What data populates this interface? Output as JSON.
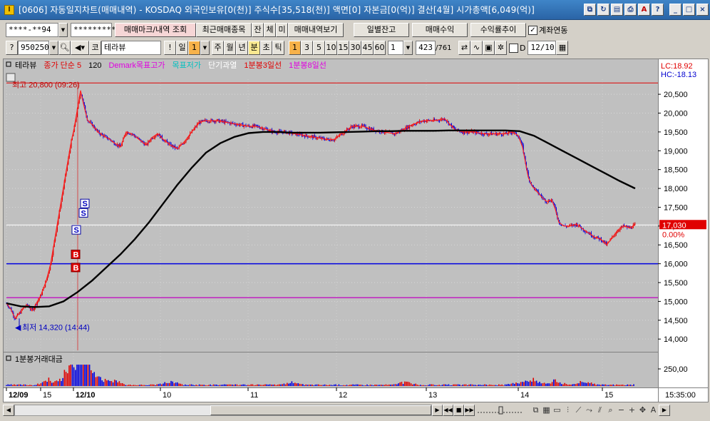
{
  "window": {
    "app_icon": "I",
    "title": "[0606] 자동일지차트(매매내역) - KOSDAQ 외국인보유[0(천)] 주식수[35,518(천)] 액면[0] 자본금[0(억)] 결산[4월] 시가총액[6,049(억)]",
    "title_icons": [
      "link-icon",
      "refresh-icon",
      "window-list-icon",
      "print-icon",
      "font-icon",
      "help-icon"
    ],
    "title_icon_glyphs": [
      "⧉",
      "↻",
      "▤",
      "⎙",
      "A",
      "?"
    ],
    "controls": [
      "_",
      "□",
      "×"
    ]
  },
  "toolbar1": {
    "account": "****-**94",
    "password": "*********",
    "btn_trade_mark": "매매마크/내역 조회",
    "btn_recent": "최근매매종목",
    "btn_jan": "잔",
    "btn_che": "체",
    "btn_mi": "미",
    "btn_history": "매매내역보기",
    "btn_daily_balance": "일별잔고",
    "btn_trade_profit": "매매수익",
    "btn_return_trend": "수익률추이",
    "account_link_checked": true,
    "account_link_label": "계좌연동"
  },
  "toolbar2": {
    "code": "950250",
    "market": "코",
    "stock_name": "테라뷰",
    "excl": "!",
    "period_day": "일",
    "period_num": "1",
    "periods": [
      "주",
      "월",
      "년",
      "분",
      "초",
      "틱"
    ],
    "selected_period": "분",
    "intervals": [
      "1",
      "3",
      "5",
      "10",
      "15",
      "30",
      "45",
      "60"
    ],
    "selected_interval": "1",
    "custom_interval": "1",
    "count": "423",
    "count_total": "/761",
    "d_label": "D",
    "date": "12/10"
  },
  "chart_data": [
    {
      "type": "candlestick",
      "legend": [
        {
          "text": "테라뷰",
          "color": "#000000"
        },
        {
          "text": "종가 단순 5",
          "color": "#e00000"
        },
        {
          "text": "120",
          "color": "#000000"
        },
        {
          "text": "Demark목표고가",
          "color": "#e000e0"
        },
        {
          "text": "목표저가",
          "color": "#00c0c0"
        },
        {
          "text": "단기과열",
          "color": "#ffffff"
        },
        {
          "text": "1분봉3일선",
          "color": "#e00000"
        },
        {
          "text": "1분봉8일선",
          "color": "#e000e0"
        }
      ],
      "ylim": [
        13700,
        20900
      ],
      "y_ticks": [
        14000,
        14500,
        15000,
        15500,
        16000,
        16500,
        17000,
        17500,
        18000,
        18500,
        19000,
        19500,
        20000,
        20500
      ],
      "y_tick_labels": [
        "14,000",
        "14,500",
        "15,000",
        "15,500",
        "16,000",
        "16,500",
        "17,000",
        "17,500",
        "18,000",
        "18,500",
        "19,000",
        "19,500",
        "20,000",
        "20,500"
      ],
      "lc_label": "LC:18.92",
      "hc_label": "HC:-18.13",
      "high": {
        "value": 20800,
        "label": "최고 20,800 (09:26)"
      },
      "low": {
        "value": 14320,
        "label": "최저 14,320 (14:44)"
      },
      "current": {
        "value": 17030,
        "label": "17,030",
        "pct": "0.00%"
      },
      "hline_blue": 16000,
      "hline_purple": 15100,
      "close_path": [
        [
          0,
          14950
        ],
        [
          6,
          14800
        ],
        [
          12,
          14550
        ],
        [
          18,
          14680
        ],
        [
          25,
          14850
        ],
        [
          30,
          14900
        ],
        [
          36,
          14750
        ],
        [
          42,
          14950
        ],
        [
          48,
          15150
        ],
        [
          55,
          15500
        ],
        [
          58,
          15700
        ],
        [
          62,
          16000
        ],
        [
          66,
          16450
        ],
        [
          70,
          16900
        ],
        [
          74,
          17350
        ],
        [
          78,
          17800
        ],
        [
          82,
          18250
        ],
        [
          86,
          18700
        ],
        [
          90,
          19150
        ],
        [
          95,
          19600
        ],
        [
          100,
          20150
        ],
        [
          104,
          20600
        ],
        [
          108,
          20250
        ],
        [
          114,
          19800
        ],
        [
          120,
          19700
        ],
        [
          128,
          19500
        ],
        [
          136,
          19400
        ],
        [
          145,
          19300
        ],
        [
          152,
          19200
        ],
        [
          160,
          19100
        ],
        [
          168,
          19500
        ],
        [
          176,
          19450
        ],
        [
          186,
          19300
        ],
        [
          196,
          19150
        ],
        [
          204,
          19350
        ],
        [
          212,
          19450
        ],
        [
          220,
          19300
        ],
        [
          230,
          19150
        ],
        [
          240,
          19050
        ],
        [
          250,
          19250
        ],
        [
          260,
          19500
        ],
        [
          270,
          19750
        ],
        [
          280,
          19800
        ],
        [
          295,
          19800
        ],
        [
          310,
          19750
        ],
        [
          325,
          19700
        ],
        [
          340,
          19650
        ],
        [
          350,
          19650
        ],
        [
          360,
          19600
        ],
        [
          375,
          19500
        ],
        [
          390,
          19500
        ],
        [
          405,
          19450
        ],
        [
          420,
          19400
        ],
        [
          435,
          19350
        ],
        [
          450,
          19300
        ],
        [
          460,
          19300
        ],
        [
          470,
          19450
        ],
        [
          485,
          19650
        ],
        [
          500,
          19650
        ],
        [
          515,
          19550
        ],
        [
          530,
          19500
        ],
        [
          545,
          19450
        ],
        [
          555,
          19550
        ],
        [
          570,
          19700
        ],
        [
          585,
          19800
        ],
        [
          600,
          19800
        ],
        [
          615,
          19850
        ],
        [
          622,
          19700
        ],
        [
          630,
          19550
        ],
        [
          640,
          19500
        ],
        [
          655,
          19500
        ],
        [
          670,
          19450
        ],
        [
          685,
          19450
        ],
        [
          700,
          19450
        ],
        [
          710,
          19500
        ],
        [
          718,
          19400
        ],
        [
          724,
          19100
        ],
        [
          728,
          18700
        ],
        [
          732,
          18300
        ],
        [
          738,
          18050
        ],
        [
          745,
          17900
        ],
        [
          752,
          17750
        ],
        [
          758,
          17650
        ],
        [
          765,
          17700
        ],
        [
          770,
          17450
        ],
        [
          775,
          17100
        ],
        [
          782,
          17000
        ],
        [
          790,
          17000
        ],
        [
          800,
          17050
        ],
        [
          810,
          16900
        ],
        [
          818,
          16800
        ],
        [
          826,
          16700
        ],
        [
          834,
          16650
        ],
        [
          842,
          16500
        ],
        [
          850,
          16700
        ],
        [
          858,
          16900
        ],
        [
          866,
          17000
        ],
        [
          874,
          16950
        ],
        [
          882,
          17030
        ]
      ],
      "ma120_path": [
        [
          0,
          14950
        ],
        [
          20,
          14870
        ],
        [
          40,
          14850
        ],
        [
          60,
          14870
        ],
        [
          80,
          15000
        ],
        [
          100,
          15250
        ],
        [
          120,
          15550
        ],
        [
          140,
          15900
        ],
        [
          160,
          16250
        ],
        [
          180,
          16650
        ],
        [
          200,
          17100
        ],
        [
          220,
          17600
        ],
        [
          240,
          18100
        ],
        [
          260,
          18550
        ],
        [
          280,
          18950
        ],
        [
          300,
          19200
        ],
        [
          320,
          19370
        ],
        [
          340,
          19470
        ],
        [
          360,
          19500
        ],
        [
          380,
          19500
        ],
        [
          400,
          19480
        ],
        [
          420,
          19480
        ],
        [
          440,
          19480
        ],
        [
          460,
          19490
        ],
        [
          480,
          19500
        ],
        [
          500,
          19510
        ],
        [
          520,
          19520
        ],
        [
          540,
          19520
        ],
        [
          560,
          19530
        ],
        [
          580,
          19530
        ],
        [
          600,
          19530
        ],
        [
          620,
          19540
        ],
        [
          640,
          19540
        ],
        [
          660,
          19540
        ],
        [
          680,
          19540
        ],
        [
          700,
          19540
        ],
        [
          720,
          19520
        ],
        [
          740,
          19400
        ],
        [
          760,
          19200
        ],
        [
          780,
          19000
        ],
        [
          800,
          18800
        ],
        [
          820,
          18600
        ],
        [
          840,
          18400
        ],
        [
          860,
          18200
        ],
        [
          882,
          18000
        ]
      ],
      "markers": [
        {
          "label": "S",
          "x": 110,
          "value": 17600
        },
        {
          "label": "S",
          "x": 108,
          "value": 17350
        },
        {
          "label": "S",
          "x": 98,
          "value": 16900
        },
        {
          "label": "B",
          "x": 97,
          "value": 16250
        },
        {
          "label": "B",
          "x": 97,
          "value": 15900
        }
      ]
    },
    {
      "type": "bar",
      "legend": [
        {
          "text": "1분봉거래대금",
          "color": "#000000"
        }
      ],
      "y_tick_labels": [
        "250,00"
      ],
      "ylim": [
        0,
        300
      ],
      "volume_bursts": [
        {
          "x": 60,
          "value": 60
        },
        {
          "x": 85,
          "value": 120
        },
        {
          "x": 95,
          "value": 180
        },
        {
          "x": 105,
          "value": 220
        },
        {
          "x": 115,
          "value": 140
        },
        {
          "x": 130,
          "value": 80
        },
        {
          "x": 150,
          "value": 60
        },
        {
          "x": 230,
          "value": 40
        },
        {
          "x": 400,
          "value": 30
        },
        {
          "x": 560,
          "value": 35
        },
        {
          "x": 720,
          "value": 40
        },
        {
          "x": 740,
          "value": 70
        },
        {
          "x": 770,
          "value": 55
        },
        {
          "x": 810,
          "value": 40
        }
      ]
    }
  ],
  "x_axis": {
    "labels": [
      "12/09",
      "15",
      "12/10",
      "10",
      "11",
      "12",
      "13",
      "14",
      "15"
    ],
    "time_label": "15:35:00"
  },
  "bottom_bar": {
    "nav_glyphs": [
      "▶",
      "◀◀",
      "■",
      "▶▶"
    ]
  }
}
